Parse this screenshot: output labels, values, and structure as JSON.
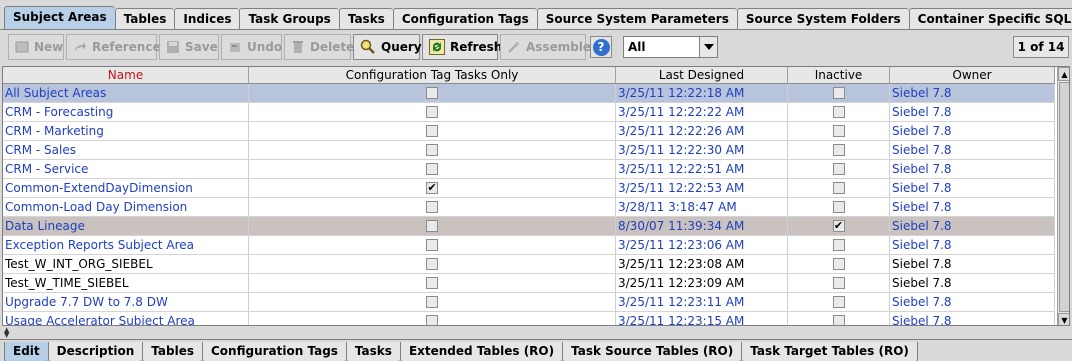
{
  "top_tabs": [
    {
      "label": "Subject Areas",
      "active": true
    },
    {
      "label": "Tables"
    },
    {
      "label": "Indices"
    },
    {
      "label": "Task Groups"
    },
    {
      "label": "Tasks"
    },
    {
      "label": "Configuration Tags"
    },
    {
      "label": "Source System Parameters"
    },
    {
      "label": "Source System Folders"
    },
    {
      "label": "Container Specific SQLs"
    }
  ],
  "toolbar": {
    "new": "New",
    "reference": "Reference",
    "save": "Save",
    "undo": "Undo",
    "delete": "Delete",
    "query": "Query",
    "refresh": "Refresh",
    "assemble": "Assemble",
    "help_symbol": "?",
    "filter_value": "All",
    "pager": "1 of 14"
  },
  "table": {
    "columns": [
      "Name",
      "Configuration Tag Tasks Only",
      "Last Designed",
      "Inactive",
      "Owner"
    ],
    "rows": [
      {
        "name": "All Subject Areas",
        "config_tag_only": false,
        "last_designed": "3/25/11 12:22:18 AM",
        "inactive": false,
        "owner": "Siebel 7.8",
        "state": "selected"
      },
      {
        "name": "CRM - Forecasting",
        "config_tag_only": false,
        "last_designed": "3/25/11 12:22:22 AM",
        "inactive": false,
        "owner": "Siebel 7.8"
      },
      {
        "name": "CRM - Marketing",
        "config_tag_only": false,
        "last_designed": "3/25/11 12:22:26 AM",
        "inactive": false,
        "owner": "Siebel 7.8"
      },
      {
        "name": "CRM - Sales",
        "config_tag_only": false,
        "last_designed": "3/25/11 12:22:30 AM",
        "inactive": false,
        "owner": "Siebel 7.8"
      },
      {
        "name": "CRM - Service",
        "config_tag_only": false,
        "last_designed": "3/25/11 12:22:51 AM",
        "inactive": false,
        "owner": "Siebel 7.8"
      },
      {
        "name": "Common-ExtendDayDimension",
        "config_tag_only": true,
        "last_designed": "3/25/11 12:22:53 AM",
        "inactive": false,
        "owner": "Siebel 7.8"
      },
      {
        "name": "Common-Load Day Dimension",
        "config_tag_only": false,
        "last_designed": "3/28/11 3:18:47 AM",
        "inactive": false,
        "owner": "Siebel 7.8"
      },
      {
        "name": "Data Lineage",
        "config_tag_only": false,
        "last_designed": "8/30/07 11:39:34 AM",
        "inactive": true,
        "owner": "Siebel 7.8",
        "state": "highlight"
      },
      {
        "name": "Exception Reports Subject Area",
        "config_tag_only": false,
        "last_designed": "3/25/11 12:23:06 AM",
        "inactive": false,
        "owner": "Siebel 7.8"
      },
      {
        "name": "Test_W_INT_ORG_SIEBEL",
        "config_tag_only": false,
        "last_designed": "3/25/11 12:23:08 AM",
        "inactive": false,
        "owner": "Siebel 7.8",
        "text": "black"
      },
      {
        "name": "Test_W_TIME_SIEBEL",
        "config_tag_only": false,
        "last_designed": "3/25/11 12:23:09 AM",
        "inactive": false,
        "owner": "Siebel 7.8",
        "text": "black"
      },
      {
        "name": "Upgrade 7.7 DW to 7.8 DW",
        "config_tag_only": false,
        "last_designed": "3/25/11 12:23:11 AM",
        "inactive": false,
        "owner": "Siebel 7.8"
      },
      {
        "name": "Usage Accelerator Subject Area",
        "config_tag_only": false,
        "last_designed": "3/25/11 12:23:15 AM",
        "inactive": false,
        "owner": "Siebel 7.8"
      }
    ]
  },
  "bottom_tabs": [
    {
      "label": "Edit",
      "active": true
    },
    {
      "label": "Description"
    },
    {
      "label": "Tables"
    },
    {
      "label": "Configuration Tags"
    },
    {
      "label": "Tasks"
    },
    {
      "label": "Extended Tables (RO)"
    },
    {
      "label": "Task Source Tables (RO)"
    },
    {
      "label": "Task Target Tables (RO)"
    }
  ],
  "colors": {
    "link_blue": "#1f3fbf",
    "name_header_red": "#c0161c",
    "selected_row": "#b7c4dc",
    "highlight_row": "#c9c2bf",
    "active_tab": "#b8cfe8"
  }
}
